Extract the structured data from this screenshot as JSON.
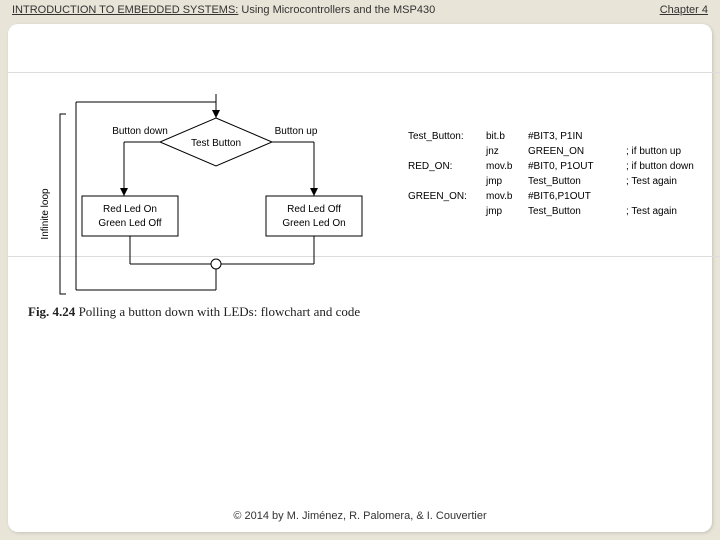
{
  "header": {
    "title_main": "INTRODUCTION TO EMBEDDED SYSTEMS:",
    "title_sub": " Using Microcontrollers and the MSP430",
    "chapter": "Chapter 4"
  },
  "flowchart": {
    "side_label": "Infinite loop",
    "test_node": "Test Button",
    "branch_left": "Button down",
    "branch_right": "Button up",
    "box_left_l1": "Red Led  On",
    "box_left_l2": "Green Led Off",
    "box_right_l1": "Red Led  Off",
    "box_right_l2": "Green Led On"
  },
  "code": {
    "rows": [
      {
        "label": "Test_Button:",
        "op": "bit.b",
        "arg": "#BIT3, P1IN",
        "cmt": ""
      },
      {
        "label": "",
        "op": "jnz",
        "arg": "GREEN_ON",
        "cmt": "; if button up"
      },
      {
        "label": "RED_ON:",
        "op": "mov.b",
        "arg": "#BIT0, P1OUT",
        "cmt": "; if button down"
      },
      {
        "label": "",
        "op": "jmp",
        "arg": "Test_Button",
        "cmt": "; Test again"
      },
      {
        "label": "GREEN_ON:",
        "op": "mov.b",
        "arg": "#BIT6,P1OUT",
        "cmt": ""
      },
      {
        "label": "",
        "op": "jmp",
        "arg": "Test_Button",
        "cmt": "; Test again"
      }
    ]
  },
  "caption": {
    "fignum": "Fig. 4.24",
    "text": "  Polling a button down with LEDs: flowchart and code"
  },
  "footer": "© 2014 by M. Jiménez, R. Palomera, & I. Couvertier"
}
